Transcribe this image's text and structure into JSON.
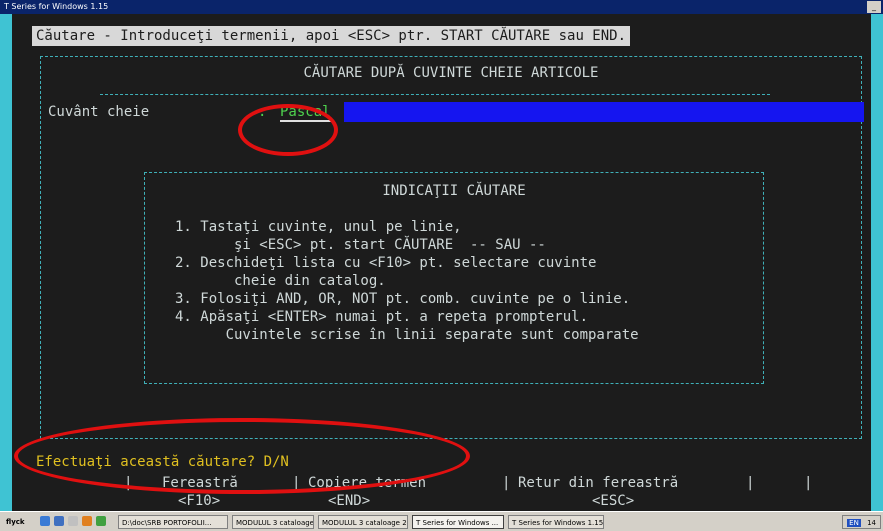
{
  "window": {
    "title": "T Series for Windows 1.15",
    "minimize_label": "_"
  },
  "console": {
    "prompt": "Căutare - Introduceţi termenii, apoi <ESC> ptr. START CĂUTARE sau END.",
    "panel_title": "CĂUTARE DUPĂ CUVINTE CHEIE ARTICOLE",
    "field": {
      "label": "Cuvânt cheie",
      "colon": ":",
      "value": "Pascal"
    },
    "hints": {
      "title": "INDICAŢII CĂUTARE",
      "lines": [
        "1. Tastaţi cuvinte, unul pe linie,",
        "       şi <ESC> pt. start CĂUTARE  -- SAU --",
        "2. Deschideţi lista cu <F10> pt. selectare cuvinte",
        "       cheie din catalog.",
        "3. Folosiţi AND, OR, NOT pt. comb. cuvinte pe o linie.",
        "4. Apăsaţi <ENTER> numai pt. a repeta prompterul.",
        "      Cuvintele scrise în linii separate sunt comparate"
      ]
    },
    "status": "Efectuaţi această căutare? D/N",
    "function_keys": [
      {
        "name": "Fereastră",
        "key": "<F10>"
      },
      {
        "name": "Copiere termen",
        "key": "<END>"
      },
      {
        "name": "Retur din fereastră",
        "key": "<ESC>"
      }
    ],
    "colors": {
      "background": "#1c1c1c",
      "prompt_bar": "#d8d8d8",
      "field_fill": "#1515f0",
      "field_text": "#4ed24e",
      "status_text": "#e0c020",
      "border": "#3fb0b8"
    }
  },
  "taskbar": {
    "start_label": "flyck",
    "items": [
      {
        "label": "D:\\doc\\SRB PORTOFOLII..."
      },
      {
        "label": "MODULUL 3 cataloage"
      },
      {
        "label": "MODULUL 3 cataloage 2..."
      },
      {
        "label": "T Series for Windows ..."
      },
      {
        "label": "T Series for Windows 1.15"
      }
    ],
    "tray": {
      "language": "EN",
      "clock": "14"
    }
  },
  "annotations": {
    "color": "#e01010"
  }
}
